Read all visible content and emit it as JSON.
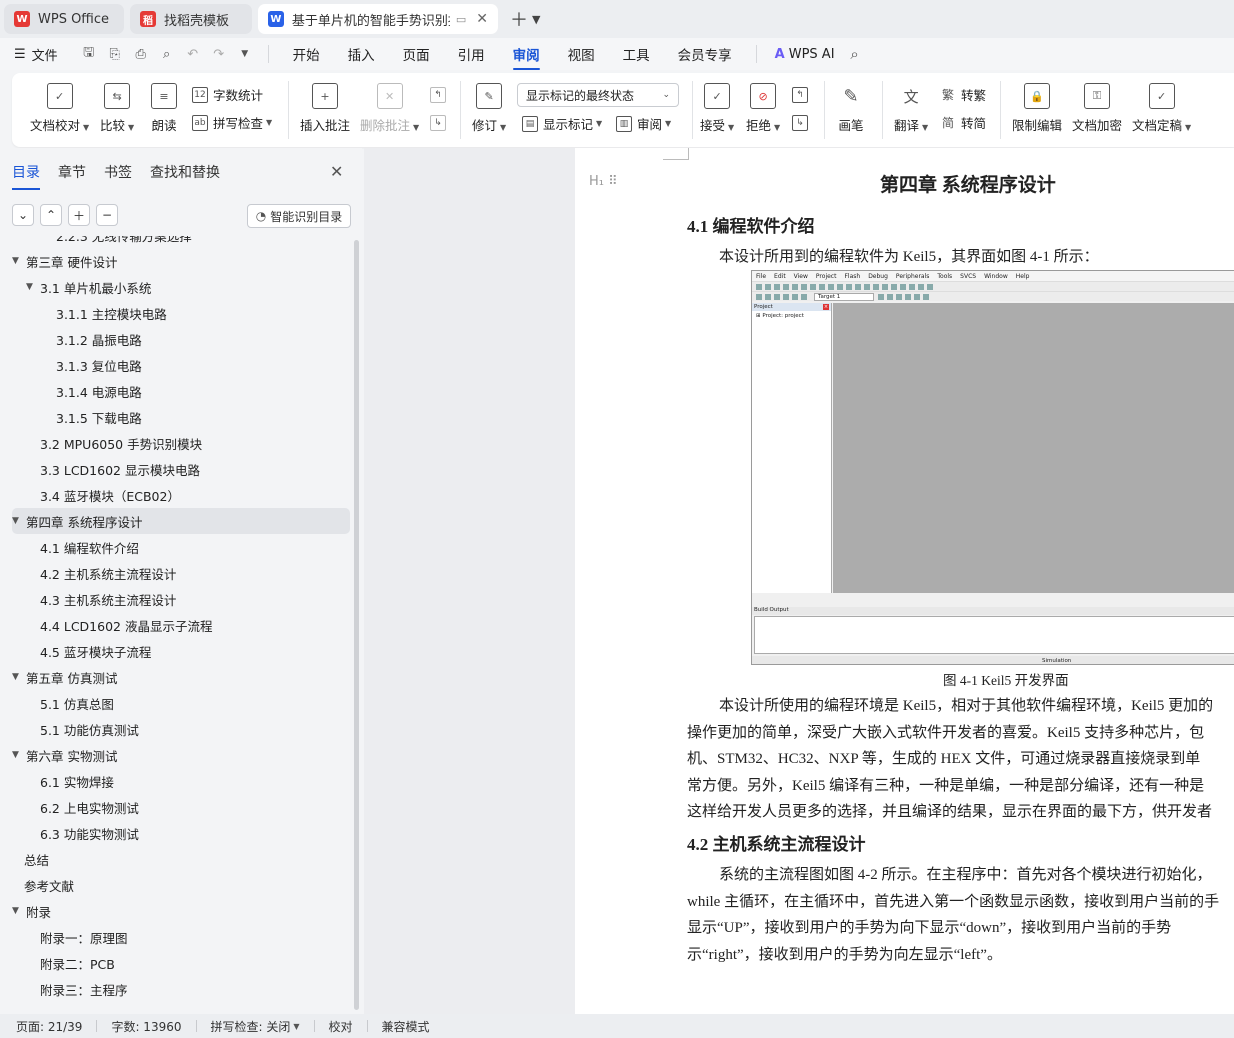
{
  "tabs": [
    {
      "label": "WPS Office",
      "icon": "wps-logo-icon",
      "color": "#e53935"
    },
    {
      "label": "找稻壳模板",
      "icon": "daoke-logo-icon",
      "color": "#e53935"
    },
    {
      "label": "基于单片机的智能手势识别控...",
      "icon": "word-doc-icon",
      "color": "#2a62e8"
    }
  ],
  "menubar": {
    "file_label": "文件",
    "items": [
      "开始",
      "插入",
      "页面",
      "引用",
      "审阅",
      "视图",
      "工具",
      "会员专享"
    ],
    "active": "审阅",
    "ai_label": "WPS AI"
  },
  "ribbon": {
    "doc_check": "文档校对",
    "compare": "比较",
    "read_aloud": "朗读",
    "word_count": "字数统计",
    "spell_check": "拼写检查",
    "insert_comment": "插入批注",
    "delete_comment": "删除批注",
    "revise": "修订",
    "markup_combo": "显示标记的最终状态",
    "show_markup": "显示标记",
    "review_pane": "审阅",
    "accept": "接受",
    "reject": "拒绝",
    "pen": "画笔",
    "translate": "翻译",
    "to_traditional": "转繁",
    "to_simplified": "转简",
    "restrict_edit": "限制编辑",
    "encrypt": "文档加密",
    "finalize": "文档定稿"
  },
  "nav": {
    "tabs": [
      "目录",
      "章节",
      "书签",
      "查找和替换"
    ],
    "smart_toc": "智能识别目录",
    "toc": [
      {
        "label": "2.2.3  无线传输方案选择",
        "level": 3
      },
      {
        "label": "第三章  硬件设计",
        "level": 1,
        "arrow": "▼"
      },
      {
        "label": "3.1 单片机最小系统",
        "level": 2,
        "arrow": "▼"
      },
      {
        "label": "3.1.1 主控模块电路",
        "level": 3
      },
      {
        "label": "3.1.2  晶振电路",
        "level": 3
      },
      {
        "label": "3.1.3  复位电路",
        "level": 3
      },
      {
        "label": "3.1.4  电源电路",
        "level": 3
      },
      {
        "label": "3.1.5 下载电路",
        "level": 3
      },
      {
        "label": "3.2 MPU6050 手势识别模块",
        "level": 2
      },
      {
        "label": "3.3 LCD1602 显示模块电路",
        "level": 2
      },
      {
        "label": "3.4  蓝牙模块（ECB02）",
        "level": 2
      },
      {
        "label": "第四章  系统程序设计",
        "level": 1,
        "arrow": "▼",
        "selected": true
      },
      {
        "label": "4.1  编程软件介绍",
        "level": 2
      },
      {
        "label": "4.2  主机系统主流程设计",
        "level": 2
      },
      {
        "label": "4.3  主机系统主流程设计",
        "level": 2
      },
      {
        "label": "4.4 LCD1602 液晶显示子流程",
        "level": 2
      },
      {
        "label": "4.5  蓝牙模块子流程",
        "level": 2
      },
      {
        "label": "第五章  仿真测试",
        "level": 1,
        "arrow": "▼"
      },
      {
        "label": "5.1 仿真总图",
        "level": 2
      },
      {
        "label": "5.1 功能仿真测试",
        "level": 2
      },
      {
        "label": "第六章  实物测试",
        "level": 1,
        "arrow": "▼"
      },
      {
        "label": "6.1 实物焊接",
        "level": 2
      },
      {
        "label": "6.2  上电实物测试",
        "level": 2
      },
      {
        "label": "6.3 功能实物测试",
        "level": 2
      },
      {
        "label": "总结",
        "level": 1
      },
      {
        "label": "参考文献",
        "level": 1
      },
      {
        "label": "附录",
        "level": 1,
        "arrow": "▼"
      },
      {
        "label": "附录一：原理图",
        "level": 2
      },
      {
        "label": "附录二：PCB",
        "level": 2
      },
      {
        "label": "附录三：主程序",
        "level": 2
      }
    ]
  },
  "doc": {
    "chapter_title": "第四章    系统程序设计",
    "s41_title": "4.1  编程软件介绍",
    "s41_intro": "本设计所用到的编程软件为 Keil5，其界面如图 4-1 所示：",
    "figure_caption": "图 4-1  Keil5 开发界面",
    "p1": [
      "本设计所使用的编程环境是 Keil5，相对于其他软件编程环境，Keil5 更加的",
      "操作更加的简单，深受广大嵌入式软件开发者的喜爱。Keil5 支持多种芯片，包",
      "机、STM32、HC32、NXP 等，生成的 HEX 文件，可通过烧录器直接烧录到单",
      "常方便。另外，Keil5 编译有三种，一种是单编，一种是部分编译，还有一种是",
      "这样给开发人员更多的选择，并且编译的结果，显示在界面的最下方，供开发者"
    ],
    "s42_title": "4.2  主机系统主流程设计",
    "p2": [
      "系统的主流程图如图 4-2 所示。在主程序中：首先对各个模块进行初始化，",
      "while 主循环，在主循环中，首先进入第一个函数显示函数，接收到用户当前的手",
      "显示“UP”，接收到用户的手势为向下显示“down”，接收到用户当前的手势",
      "示“right”，接收到用户的手势为向左显示“left”。"
    ],
    "keil": {
      "menu": [
        "File",
        "Edit",
        "View",
        "Project",
        "Flash",
        "Debug",
        "Peripherals",
        "Tools",
        "SVCS",
        "Window",
        "Help"
      ],
      "target": "Target 1",
      "project_pane": "Project",
      "project_node": "Project: project",
      "build_output": "Build Output",
      "status": "Simulation"
    }
  },
  "statusbar": {
    "page": "页面: 21/39",
    "words": "字数: 13960",
    "spell": "拼写检查: 关闭",
    "proof": "校对",
    "compat": "兼容模式"
  }
}
